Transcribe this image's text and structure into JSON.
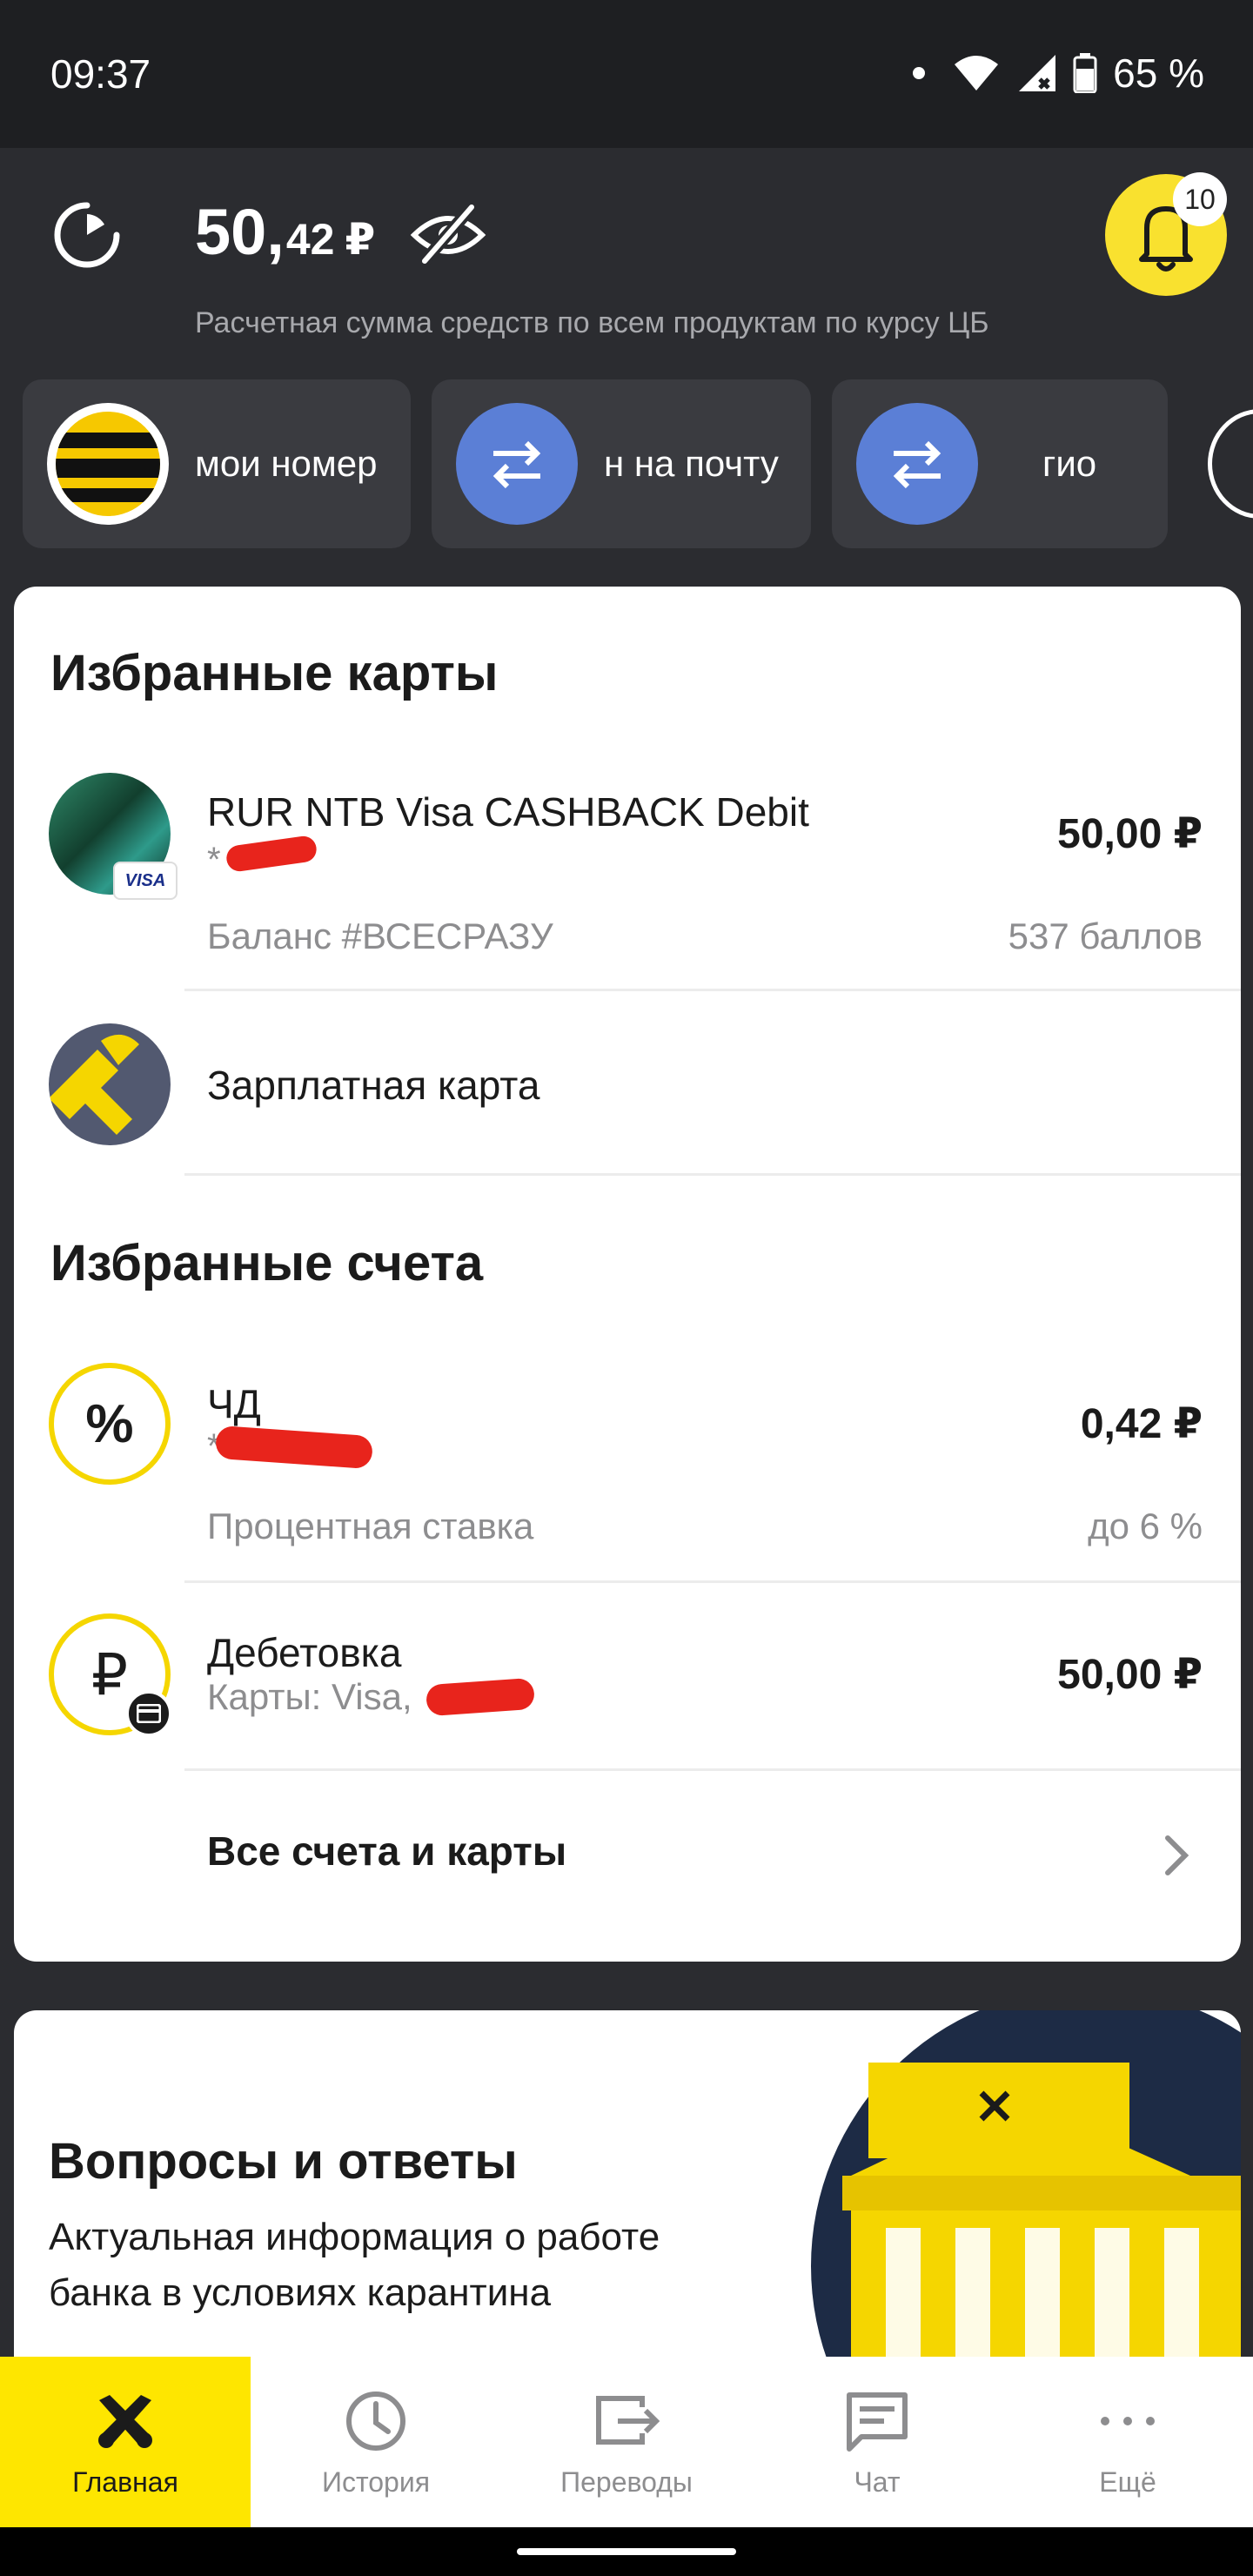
{
  "status": {
    "time": "09:37",
    "battery": "65 %"
  },
  "header": {
    "balance_main": "50,",
    "balance_cents": "42",
    "balance_currency": "₽",
    "subtitle": "Расчетная сумма средств по всем продуктам по курсу ЦБ",
    "notifications": "10"
  },
  "quick_actions": [
    {
      "label": "мои номер"
    },
    {
      "label": "н на почту"
    },
    {
      "label": "гио"
    }
  ],
  "favorites_cards": {
    "title": "Избранные карты",
    "items": [
      {
        "title": "RUR NTB Visa CASHBACK Debit",
        "number": "*",
        "amount": "50,00 ₽",
        "sub_left": "Баланс #ВСЕСРАЗУ",
        "sub_right": "537 баллов",
        "badge": "VISA"
      },
      {
        "title": "Зарплатная карта"
      }
    ]
  },
  "favorites_accounts": {
    "title": "Избранные счета",
    "items": [
      {
        "title": "ЧД",
        "number": "*",
        "amount": "0,42 ₽",
        "sub_left": "Процентная ставка",
        "sub_right": "до 6 %"
      },
      {
        "title": "Дебетовка",
        "sub_left": "Карты: Visa,",
        "amount": "50,00 ₽"
      }
    ]
  },
  "all_accounts_link": "Все счета и карты",
  "promo": {
    "title": "Вопросы и ответы",
    "text_line1": "Актуальная информация о работе",
    "text_line2": "банка в условиях карантина"
  },
  "nav": [
    {
      "label": "Главная",
      "icon": "raiffeisen-logo-icon",
      "active": true
    },
    {
      "label": "История",
      "icon": "clock-icon"
    },
    {
      "label": "Переводы",
      "icon": "transfer-icon"
    },
    {
      "label": "Чат",
      "icon": "chat-icon"
    },
    {
      "label": "Ещё",
      "icon": "more-icon"
    }
  ],
  "colors": {
    "accent_yellow": "#fee600",
    "dark_bg": "#2b2c30",
    "action_blue": "#5b7fd6",
    "redaction_red": "#e8241c"
  }
}
